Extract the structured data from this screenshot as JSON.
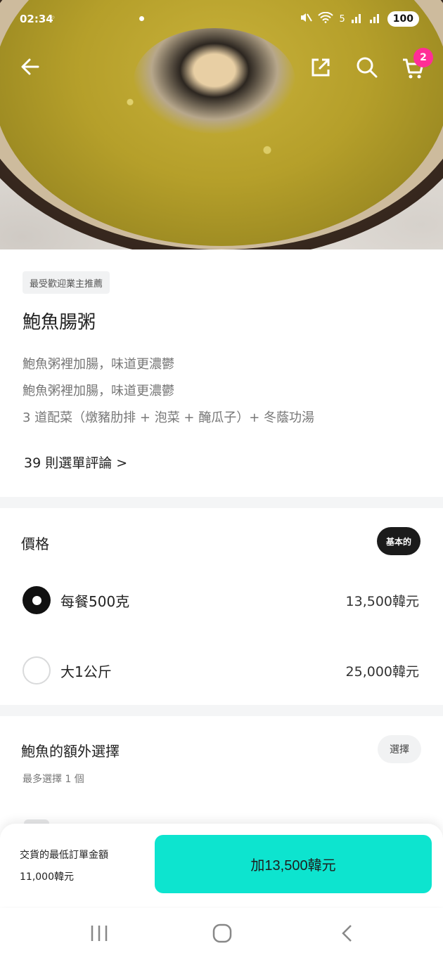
{
  "status_bar": {
    "time": "02:34",
    "time_suffix": "◦",
    "network": "5",
    "battery": "100"
  },
  "header": {
    "cart_count": "2"
  },
  "product": {
    "tag": "最受歡迎業主推薦",
    "title": "鮑魚腸粥",
    "description_lines": [
      "鮑魚粥裡加腸，味道更濃鬱",
      "鮑魚粥裡加腸，味道更濃鬱",
      "3 道配菜（燉豬肋排 + 泡菜 + 醃瓜子）+ 冬蔭功湯"
    ],
    "reviews_link": "39 則選單評論 >"
  },
  "price_section": {
    "title": "價格",
    "badge": "基本的",
    "options": [
      {
        "label": "每餐500克",
        "price": "13,500韓元",
        "selected": true
      },
      {
        "label": "大1公斤",
        "price": "25,000韓元",
        "selected": false
      }
    ]
  },
  "extra_section": {
    "title": "鮑魚的額外選擇",
    "badge": "選擇",
    "note": "最多選擇 1 個"
  },
  "bottom_bar": {
    "min_order_label": "交貨的最低訂單金額",
    "min_order_value": "11,000韓元",
    "add_button": "加13,500韓元"
  },
  "colors": {
    "accent": "#0de4cf",
    "badge": "#ff2e96"
  }
}
